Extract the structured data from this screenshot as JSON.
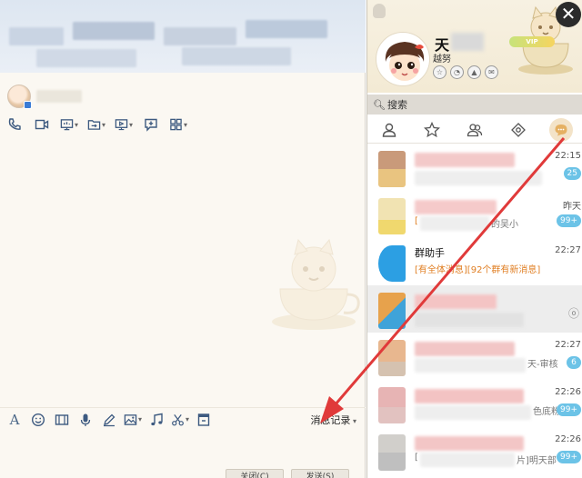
{
  "chat": {
    "toolbar_icons": [
      "phone-icon",
      "video-icon",
      "screen-share-icon",
      "file-transfer-icon",
      "remote-desktop-icon",
      "add-icon",
      "apps-icon"
    ],
    "input_icons": [
      "font-icon",
      "emoji-icon",
      "magic-expression-icon",
      "voice-icon",
      "pen-icon",
      "image-icon",
      "music-icon",
      "screenshot-icon",
      "shake-icon"
    ],
    "history_label": "消息记录",
    "bottom_buttons": [
      "关闭(C)",
      "发送(S)"
    ]
  },
  "panel": {
    "my_name_char": "天",
    "signature": "越努",
    "vip_label": "VIP",
    "search_placeholder": "搜索",
    "close_symbol": "✕",
    "tabs": [
      "contacts-tab",
      "favorites-tab",
      "groups-tab",
      "apps-tab",
      "messages-tab"
    ]
  },
  "conversations": [
    {
      "title": "",
      "sub": "",
      "time": "22:15",
      "badge": "25",
      "colors": [
        "#c99a7a",
        "#e9c480"
      ]
    },
    {
      "title": "",
      "sub": "[",
      "time": "昨天",
      "badge": "99+",
      "colors": [
        "#f1e3b2",
        "#f0d86e"
      ],
      "sub_suffix": "的吴小"
    },
    {
      "title": "群助手",
      "sub": "[有全体消息][92个群有新消息]",
      "time": "22:27",
      "badge": "",
      "colors": [
        "#2c9fe3",
        "#2c9fe3"
      ]
    },
    {
      "title": "",
      "sub": "",
      "time": "",
      "badge": "",
      "mute": "ⓞ",
      "colors": [
        "#e7a24c",
        "#3fa3d9"
      ]
    },
    {
      "title": "",
      "sub": "",
      "time": "22:27",
      "badge": "6",
      "colors": [
        "#e8b78f",
        "#d5c2b0"
      ],
      "sub_suffix": "天-审核"
    },
    {
      "title": "",
      "sub": "",
      "time": "22:26",
      "badge": "99+",
      "colors": [
        "#e7b4b4",
        "#e2c2c0"
      ],
      "sub_suffix": "色底粉"
    },
    {
      "title": "",
      "sub": "[",
      "time": "22:26",
      "badge": "99+",
      "colors": [
        "#d1cfcb",
        "#bfbfbf"
      ],
      "sub_suffix": "片]明天部"
    }
  ]
}
